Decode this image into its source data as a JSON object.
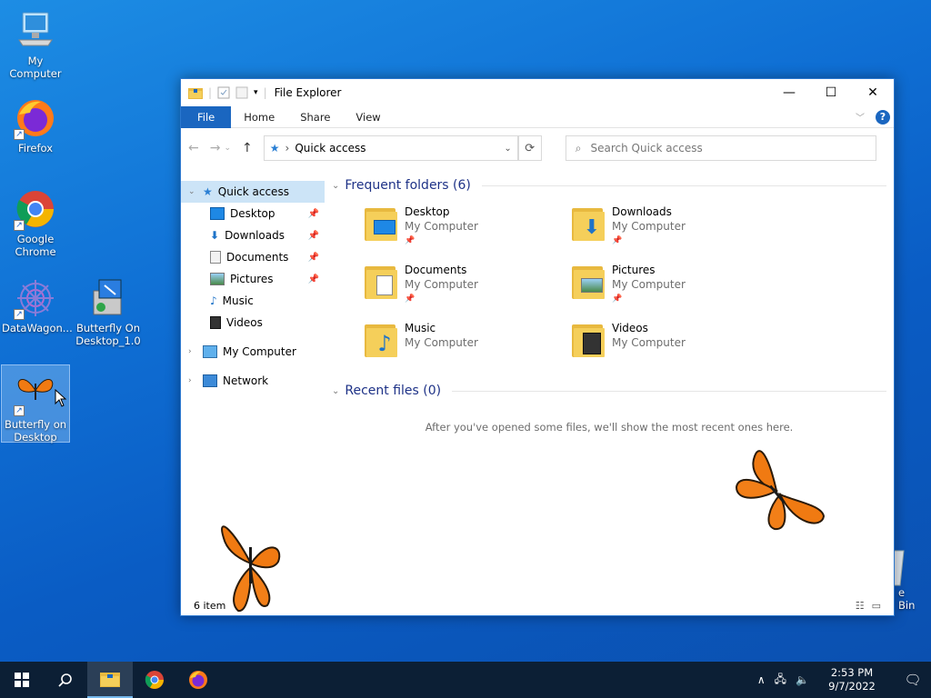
{
  "desktop": {
    "icons": [
      {
        "label": "My Computer"
      },
      {
        "label": "Firefox"
      },
      {
        "label": "Google Chrome"
      },
      {
        "label": "DataWagon..."
      },
      {
        "label": "Butterfly On Desktop_1.0"
      },
      {
        "label": "Butterfly on Desktop"
      }
    ],
    "recycle_partial": "e Bin"
  },
  "window": {
    "title": "File Explorer",
    "tabs": {
      "file": "File",
      "home": "Home",
      "share": "Share",
      "view": "View"
    },
    "help": "?",
    "address": "Quick access",
    "search_placeholder": "Search Quick access",
    "nav": {
      "quick_access": "Quick access",
      "desktop": "Desktop",
      "downloads": "Downloads",
      "documents": "Documents",
      "pictures": "Pictures",
      "music": "Music",
      "videos": "Videos",
      "my_computer": "My Computer",
      "network": "Network"
    },
    "frequent_title": "Frequent folders (6)",
    "folders": [
      {
        "name": "Desktop",
        "location": "My Computer"
      },
      {
        "name": "Downloads",
        "location": "My Computer"
      },
      {
        "name": "Documents",
        "location": "My Computer"
      },
      {
        "name": "Pictures",
        "location": "My Computer"
      },
      {
        "name": "Music",
        "location": "My Computer"
      },
      {
        "name": "Videos",
        "location": "My Computer"
      }
    ],
    "recent_title": "Recent files (0)",
    "recent_empty": "After you've opened some files, we'll show the most recent ones here.",
    "status": "6 item"
  },
  "taskbar": {
    "time": "2:53 PM",
    "date": "9/7/2022"
  },
  "colors": {
    "accent": "#1a66c0",
    "taskbar": "#0c1f35",
    "folder": "#f5cf5a"
  }
}
